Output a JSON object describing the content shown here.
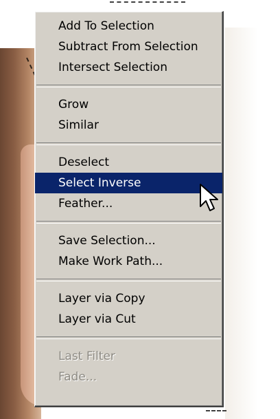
{
  "menu": {
    "groups": [
      {
        "items": [
          {
            "label": "Add To Selection",
            "enabled": true
          },
          {
            "label": "Subtract From Selection",
            "enabled": true
          },
          {
            "label": "Intersect Selection",
            "enabled": true
          }
        ]
      },
      {
        "items": [
          {
            "label": "Grow",
            "enabled": true
          },
          {
            "label": "Similar",
            "enabled": true
          }
        ]
      },
      {
        "items": [
          {
            "label": "Deselect",
            "enabled": true
          },
          {
            "label": "Select Inverse",
            "enabled": true,
            "highlighted": true
          },
          {
            "label": "Feather...",
            "enabled": true
          }
        ]
      },
      {
        "items": [
          {
            "label": "Save Selection...",
            "enabled": true
          },
          {
            "label": "Make Work Path...",
            "enabled": true
          }
        ]
      },
      {
        "items": [
          {
            "label": "Layer via Copy",
            "enabled": true
          },
          {
            "label": "Layer via Cut",
            "enabled": true
          }
        ]
      },
      {
        "items": [
          {
            "label": "Last Filter",
            "enabled": false
          },
          {
            "label": "Fade...",
            "enabled": false
          }
        ]
      }
    ]
  },
  "cursor": {
    "icon": "arrow-pointer-icon"
  },
  "colors": {
    "menu_background": "#d4d0c8",
    "highlight_background": "#0a246a",
    "highlight_text": "#ffffff",
    "disabled_text": "#8e8b84"
  }
}
